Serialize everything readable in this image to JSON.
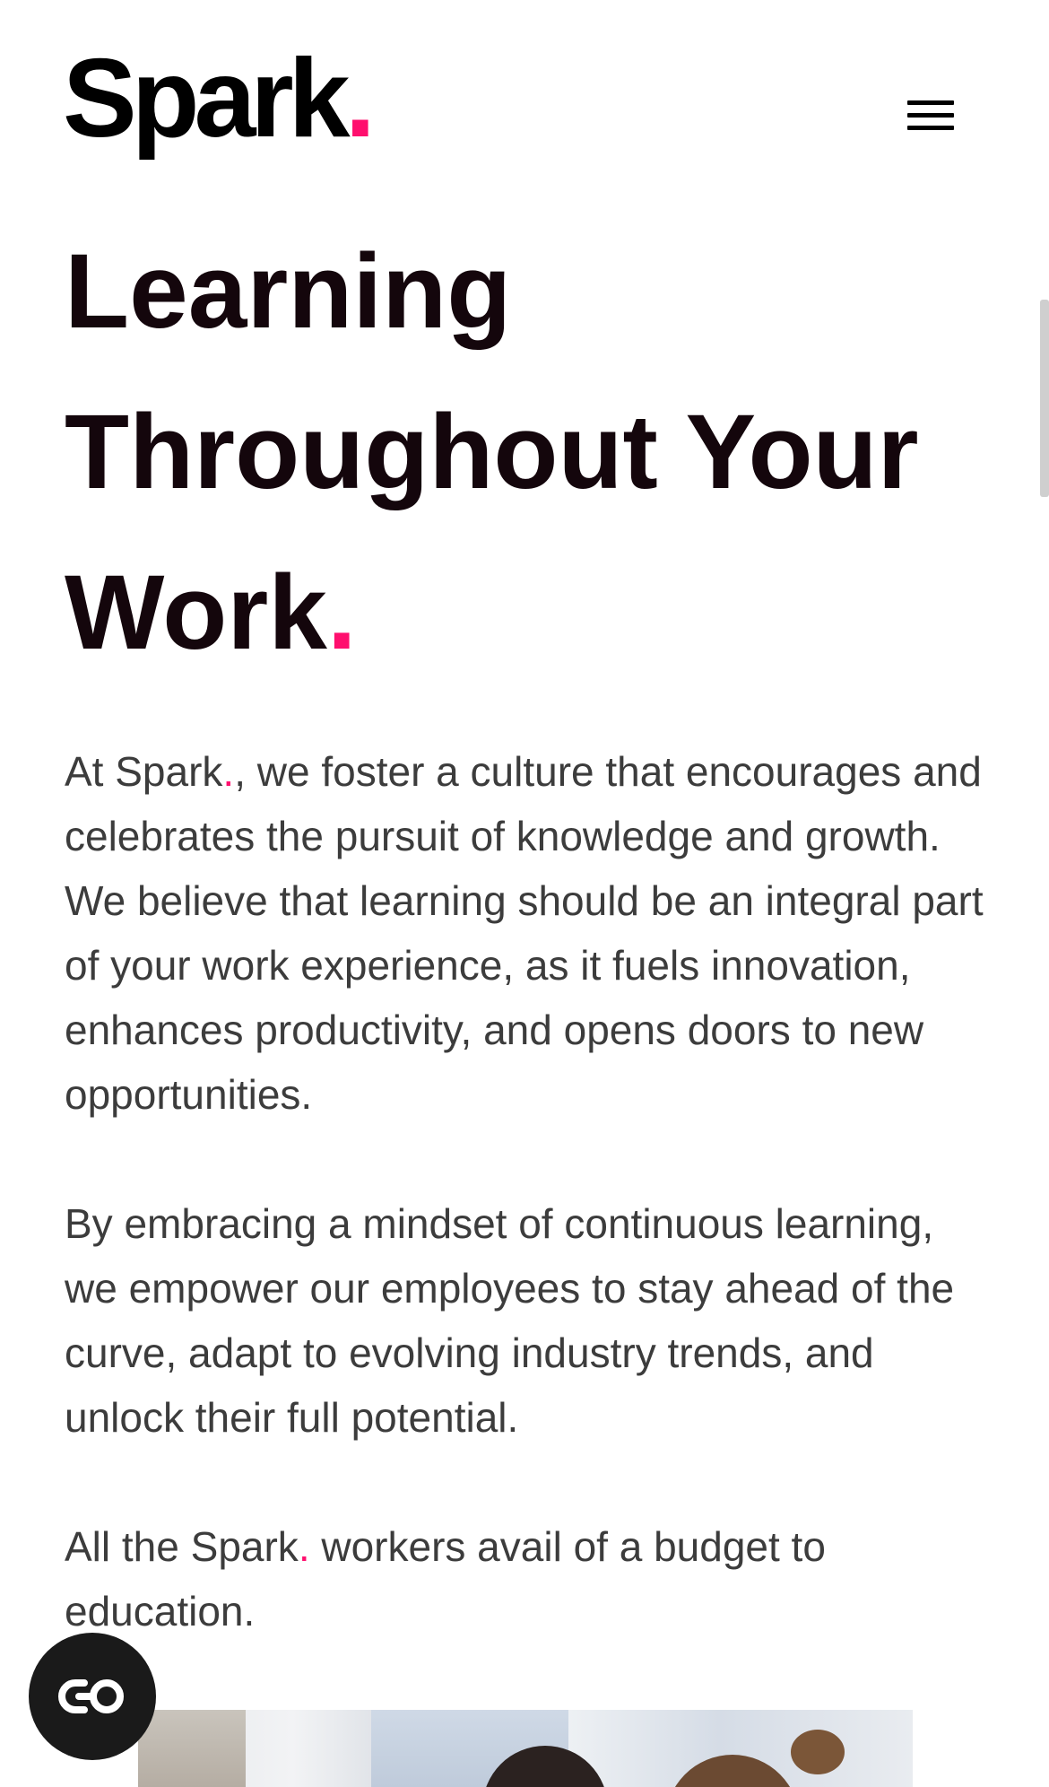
{
  "header": {
    "logo_text": "Spark",
    "logo_dot": ".",
    "menu_icon": "hamburger-menu-icon"
  },
  "headline": {
    "line1": "Learning",
    "line2": "Throughout Your",
    "line3_word": "Work",
    "line3_dot": "."
  },
  "paragraphs": {
    "p1_brand": "Spark",
    "p1_brand_dot": ".",
    "p1_before": "At ",
    "p1_after": ", we foster a culture that encourages and celebrates the pursuit of knowledge and growth. We believe that learning should be an integral part of your work experience, as it fuels innovation, enhances productivity, and opens doors to new opportunities.",
    "p2": "By embracing a mindset of continuous learning, we empower our employees to stay ahead of the curve, adapt to evolving industry trends, and unlock their full potential.",
    "p3_before": "All the ",
    "p3_brand": "Spark",
    "p3_brand_dot": ".",
    "p3_after": " workers avail of a budget to education."
  },
  "accessibility_button": {
    "icon": "accessibility-toggle-icon"
  },
  "colors": {
    "accent": "#ff0f6e",
    "heading": "#14060c",
    "body": "#3c3c3c",
    "background": "#ffffff"
  }
}
